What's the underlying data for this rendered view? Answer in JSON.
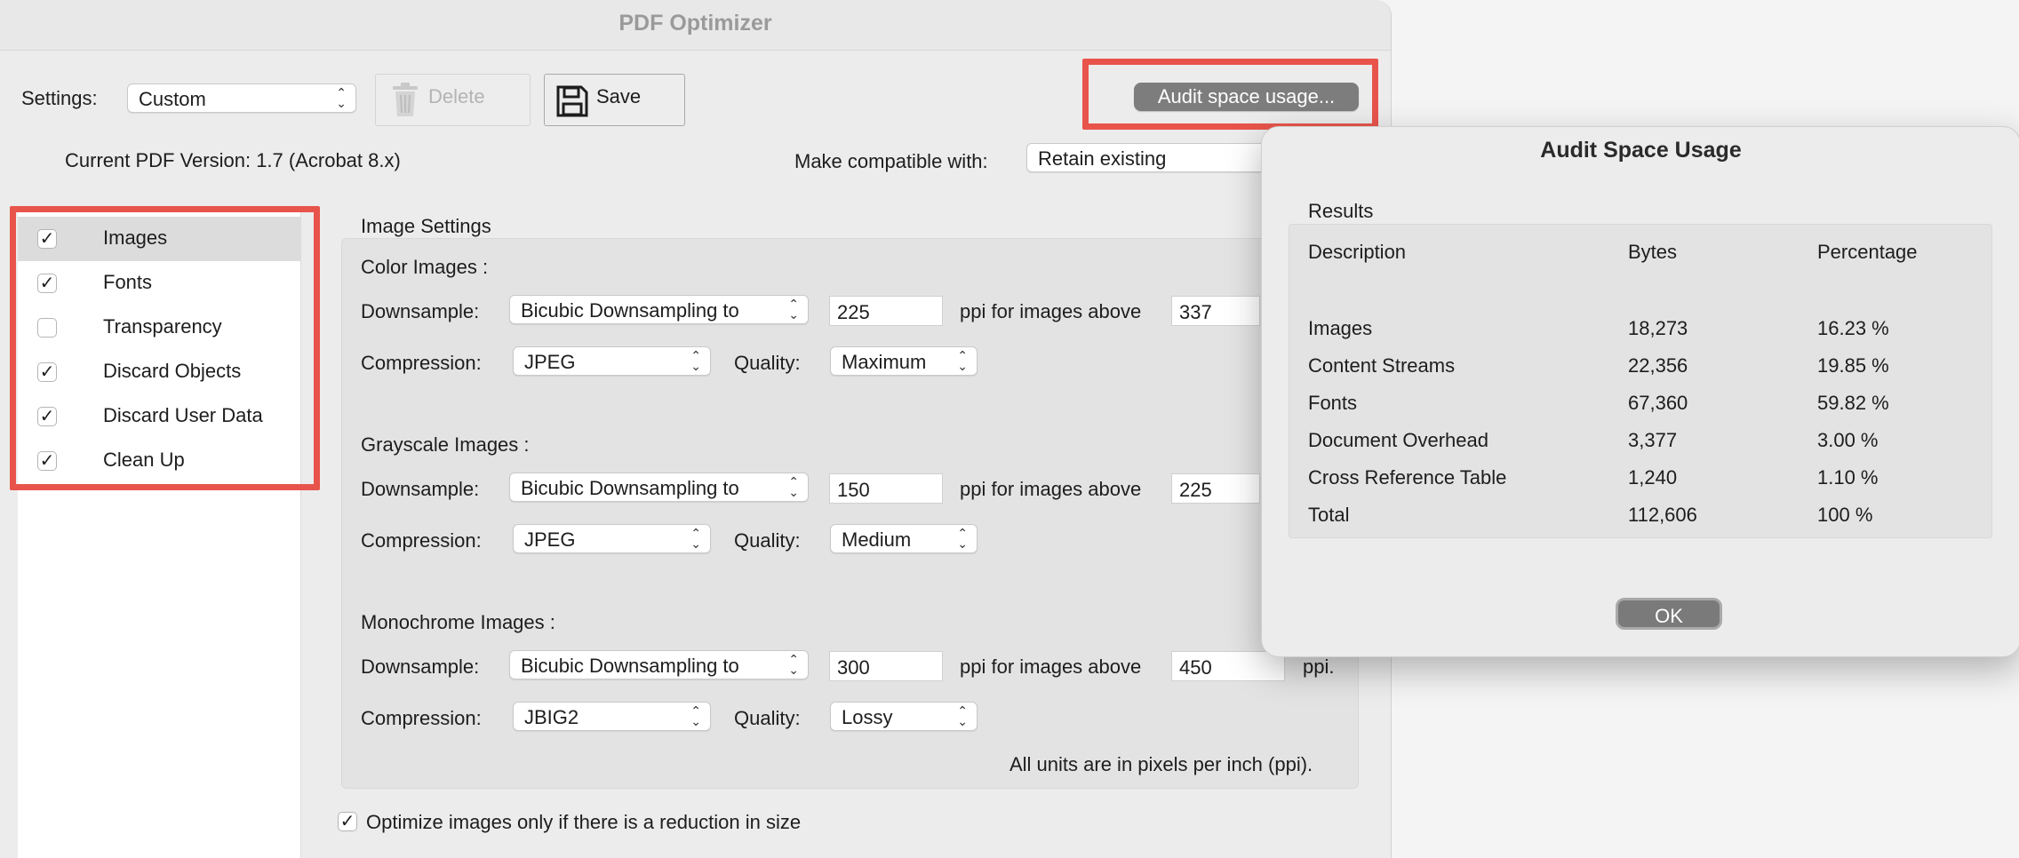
{
  "window": {
    "title": "PDF Optimizer"
  },
  "toolbar": {
    "settings_label": "Settings:",
    "settings_value": "Custom",
    "delete_label": "Delete",
    "save_label": "Save",
    "audit_label": "Audit space usage..."
  },
  "version": {
    "current_text": "Current PDF Version: 1.7 (Acrobat 8.x)",
    "compat_label": "Make compatible with:",
    "compat_value": "Retain existing"
  },
  "sidebar": {
    "items": [
      {
        "label": "Images",
        "checked": true,
        "selected": true
      },
      {
        "label": "Fonts",
        "checked": true,
        "selected": false
      },
      {
        "label": "Transparency",
        "checked": false,
        "selected": false
      },
      {
        "label": "Discard Objects",
        "checked": true,
        "selected": false
      },
      {
        "label": "Discard User Data",
        "checked": true,
        "selected": false
      },
      {
        "label": "Clean Up",
        "checked": true,
        "selected": false
      }
    ]
  },
  "image_settings": {
    "title": "Image Settings",
    "labels": {
      "downsample": "Downsample:",
      "compression": "Compression:",
      "quality": "Quality:",
      "ppi_above": "ppi for images above",
      "ppi_suffix": "ppi."
    },
    "sections": [
      {
        "title": "Color Images :",
        "downsample": "Bicubic Downsampling to",
        "ppi": "225",
        "above": "337",
        "compression": "JPEG",
        "quality": "Maximum"
      },
      {
        "title": "Grayscale Images :",
        "downsample": "Bicubic Downsampling to",
        "ppi": "150",
        "above": "225",
        "compression": "JPEG",
        "quality": "Medium"
      },
      {
        "title": "Monochrome Images :",
        "downsample": "Bicubic Downsampling to",
        "ppi": "300",
        "above": "450",
        "compression": "JBIG2",
        "quality": "Lossy"
      }
    ],
    "units_note": "All units are in pixels per inch (ppi).",
    "optimize_label": "Optimize images only if there is a reduction in size",
    "optimize_checked": true
  },
  "dialog": {
    "title": "Audit Space Usage",
    "results_label": "Results",
    "columns": [
      "Description",
      "Bytes",
      "Percentage"
    ],
    "rows": [
      [
        "Images",
        "18,273",
        "16.23 %"
      ],
      [
        "Content Streams",
        "22,356",
        "19.85 %"
      ],
      [
        "Fonts",
        "67,360",
        "59.82 %"
      ],
      [
        "Document Overhead",
        "3,377",
        "3.00 %"
      ],
      [
        "Cross Reference Table",
        "1,240",
        "1.10 %"
      ],
      [
        "Total",
        "112,606",
        "100 %"
      ]
    ],
    "ok_label": "OK"
  },
  "icons": {
    "delete": "trash-icon",
    "save": "floppy-disk-icon",
    "check": "checkmark-icon",
    "popup": "chevron-updown-icon"
  },
  "colors": {
    "highlight": "#e8544b",
    "accent_button": "#7d7d7d"
  }
}
